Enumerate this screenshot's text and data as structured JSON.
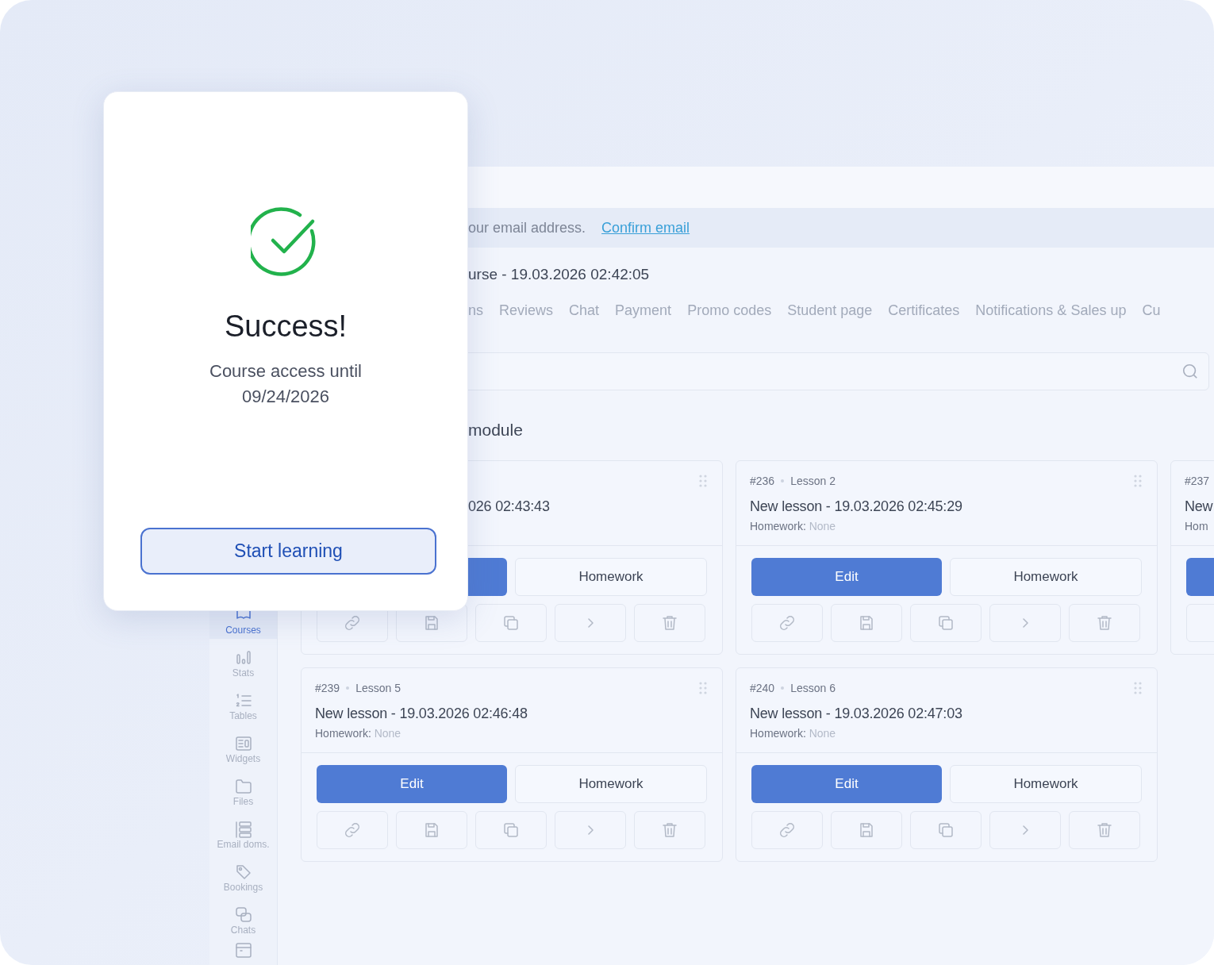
{
  "dialog": {
    "title": "Success!",
    "message": "Course access until 09/24/2026",
    "button": "Start learning"
  },
  "banner": {
    "text": "our email address.",
    "link": "Confirm email"
  },
  "course_title": "urse - 19.03.2026 02:42:05",
  "tabs": [
    {
      "label": "ns",
      "selected": false
    },
    {
      "label": "Reviews",
      "selected": false
    },
    {
      "label": "Chat",
      "selected": false
    },
    {
      "label": "Payment",
      "selected": false
    },
    {
      "label": "Promo codes",
      "selected": false
    },
    {
      "label": "Student page",
      "selected": false
    },
    {
      "label": "Certificates",
      "selected": false
    },
    {
      "label": "Notifications & Sales up",
      "selected": false
    },
    {
      "label": "Cu",
      "selected": false
    }
  ],
  "section_title": "module",
  "sidebar": [
    {
      "label": "Courses",
      "selected": true
    },
    {
      "label": "Stats",
      "selected": false
    },
    {
      "label": "Tables",
      "selected": false
    },
    {
      "label": "Widgets",
      "selected": false
    },
    {
      "label": "Files",
      "selected": false
    },
    {
      "label": "Email doms.",
      "selected": false
    },
    {
      "label": "Bookings",
      "selected": false
    },
    {
      "label": "Chats",
      "selected": false
    },
    {
      "selected": false
    }
  ],
  "lessons": [
    {
      "title": "026 02:43:43",
      "homework_button": "Homework"
    },
    {
      "id": "#236",
      "lesson": "Lesson 2",
      "title": "New lesson - 19.03.2026 02:45:29",
      "homework_label": "Homework:",
      "homework_value": "None",
      "edit": "Edit",
      "homework_button": "Homework"
    },
    {
      "id": "#237",
      "title": "New",
      "homework_label": "Hom"
    },
    {
      "id": "#239",
      "lesson": "Lesson 5",
      "title": "New lesson - 19.03.2026 02:46:48",
      "homework_label": "Homework:",
      "homework_value": "None",
      "edit": "Edit",
      "homework_button": "Homework"
    },
    {
      "id": "#240",
      "lesson": "Lesson 6",
      "title": "New lesson - 19.03.2026 02:47:03",
      "homework_label": "Homework:",
      "homework_value": "None",
      "edit": "Edit",
      "homework_button": "Homework"
    }
  ]
}
